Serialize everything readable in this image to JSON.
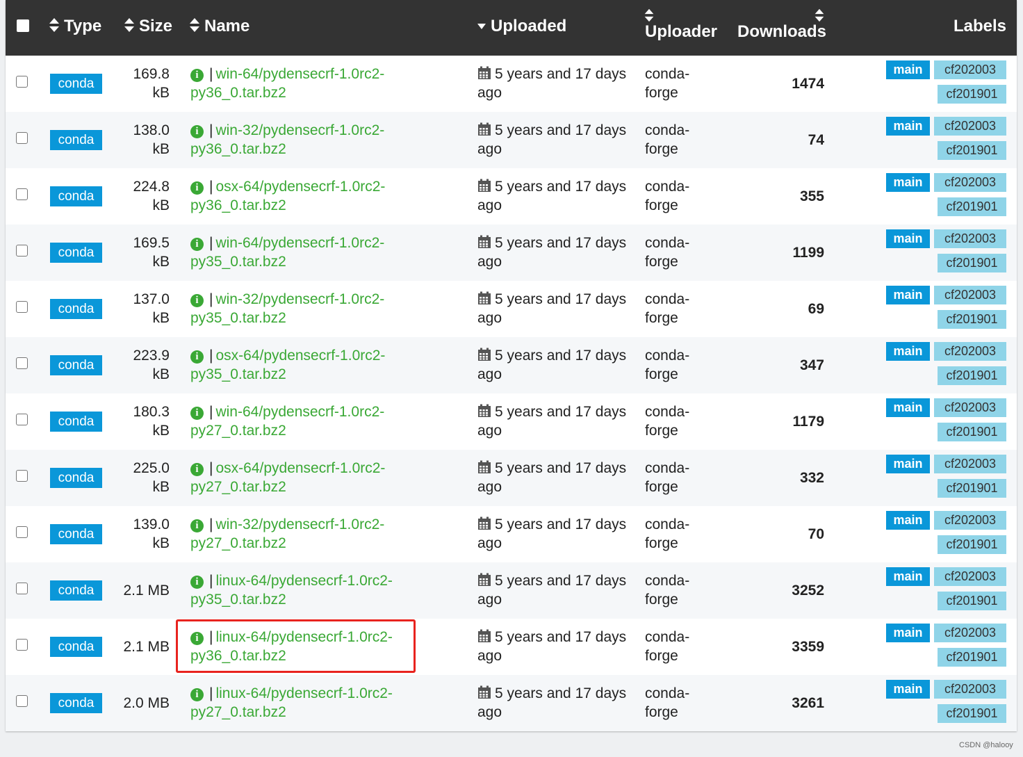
{
  "header": {
    "type": "Type",
    "size": "Size",
    "name": "Name",
    "uploaded": "Uploaded",
    "uploader": "Uploader",
    "downloads": "Downloads",
    "labels": "Labels"
  },
  "rows": [
    {
      "type": "conda",
      "size1": "169.8",
      "size2": "kB",
      "name1": "win-64/pydensecrf-1.0rc2-",
      "name2": "py36_0.tar.bz2",
      "up1": "5 years and 17 days",
      "up2": "ago",
      "u1": "conda-",
      "u2": "forge",
      "dl": "1474",
      "l1": "main",
      "l2": "cf202003",
      "l3": "cf201901"
    },
    {
      "type": "conda",
      "size1": "138.0",
      "size2": "kB",
      "name1": "win-32/pydensecrf-1.0rc2-",
      "name2": "py36_0.tar.bz2",
      "up1": "5 years and 17 days",
      "up2": "ago",
      "u1": "conda-",
      "u2": "forge",
      "dl": "74",
      "l1": "main",
      "l2": "cf202003",
      "l3": "cf201901"
    },
    {
      "type": "conda",
      "size1": "224.8",
      "size2": "kB",
      "name1": "osx-64/pydensecrf-1.0rc2-",
      "name2": "py36_0.tar.bz2",
      "up1": "5 years and 17 days",
      "up2": "ago",
      "u1": "conda-",
      "u2": "forge",
      "dl": "355",
      "l1": "main",
      "l2": "cf202003",
      "l3": "cf201901"
    },
    {
      "type": "conda",
      "size1": "169.5",
      "size2": "kB",
      "name1": "win-64/pydensecrf-1.0rc2-",
      "name2": "py35_0.tar.bz2",
      "up1": "5 years and 17 days",
      "up2": "ago",
      "u1": "conda-",
      "u2": "forge",
      "dl": "1199",
      "l1": "main",
      "l2": "cf202003",
      "l3": "cf201901"
    },
    {
      "type": "conda",
      "size1": "137.0",
      "size2": "kB",
      "name1": "win-32/pydensecrf-1.0rc2-",
      "name2": "py35_0.tar.bz2",
      "up1": "5 years and 17 days",
      "up2": "ago",
      "u1": "conda-",
      "u2": "forge",
      "dl": "69",
      "l1": "main",
      "l2": "cf202003",
      "l3": "cf201901"
    },
    {
      "type": "conda",
      "size1": "223.9",
      "size2": "kB",
      "name1": "osx-64/pydensecrf-1.0rc2-",
      "name2": "py35_0.tar.bz2",
      "up1": "5 years and 17 days",
      "up2": "ago",
      "u1": "conda-",
      "u2": "forge",
      "dl": "347",
      "l1": "main",
      "l2": "cf202003",
      "l3": "cf201901"
    },
    {
      "type": "conda",
      "size1": "180.3",
      "size2": "kB",
      "name1": "win-64/pydensecrf-1.0rc2-",
      "name2": "py27_0.tar.bz2",
      "up1": "5 years and 17 days",
      "up2": "ago",
      "u1": "conda-",
      "u2": "forge",
      "dl": "1179",
      "l1": "main",
      "l2": "cf202003",
      "l3": "cf201901"
    },
    {
      "type": "conda",
      "size1": "225.0",
      "size2": "kB",
      "name1": "osx-64/pydensecrf-1.0rc2-",
      "name2": "py27_0.tar.bz2",
      "up1": "5 years and 17 days",
      "up2": "ago",
      "u1": "conda-",
      "u2": "forge",
      "dl": "332",
      "l1": "main",
      "l2": "cf202003",
      "l3": "cf201901"
    },
    {
      "type": "conda",
      "size1": "139.0",
      "size2": "kB",
      "name1": "win-32/pydensecrf-1.0rc2-",
      "name2": "py27_0.tar.bz2",
      "up1": "5 years and 17 days",
      "up2": "ago",
      "u1": "conda-",
      "u2": "forge",
      "dl": "70",
      "l1": "main",
      "l2": "cf202003",
      "l3": "cf201901"
    },
    {
      "type": "conda",
      "size1": "2.1 MB",
      "size2": "",
      "name1": "linux-64/pydensecrf-1.0rc2-",
      "name2": "py35_0.tar.bz2",
      "up1": "5 years and 17 days",
      "up2": "ago",
      "u1": "conda-",
      "u2": "forge",
      "dl": "3252",
      "l1": "main",
      "l2": "cf202003",
      "l3": "cf201901"
    },
    {
      "type": "conda",
      "size1": "2.1 MB",
      "size2": "",
      "name1": "linux-64/pydensecrf-1.0rc2-",
      "name2": "py36_0.tar.bz2",
      "up1": "5 years and 17 days",
      "up2": "ago",
      "u1": "conda-",
      "u2": "forge",
      "dl": "3359",
      "l1": "main",
      "l2": "cf202003",
      "l3": "cf201901"
    },
    {
      "type": "conda",
      "size1": "2.0 MB",
      "size2": "",
      "name1": "linux-64/pydensecrf-1.0rc2-",
      "name2": "py27_0.tar.bz2",
      "up1": "5 years and 17 days",
      "up2": "ago",
      "u1": "conda-",
      "u2": "forge",
      "dl": "3261",
      "l1": "main",
      "l2": "cf202003",
      "l3": "cf201901"
    }
  ],
  "info_icon_glyph": "i",
  "pipe": "|",
  "watermark": "CSDN @halooy",
  "colors": {
    "header_bg": "#333333",
    "conda_badge": "#0a97d9",
    "link_green": "#3aa835",
    "label_light": "#8fd4e8",
    "highlight_red": "#e8231e"
  }
}
